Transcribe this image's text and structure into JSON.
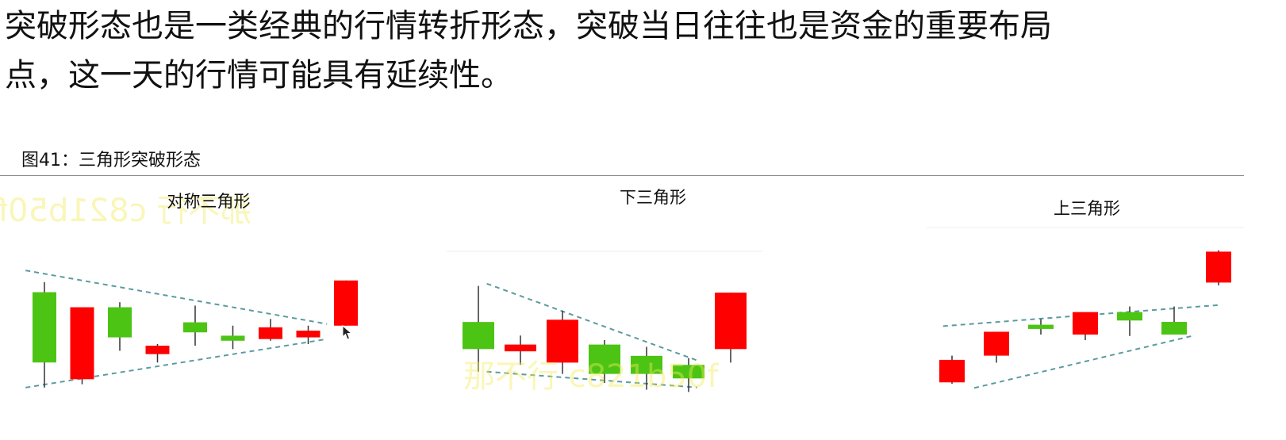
{
  "paragraph": {
    "line1": "突破形态也是一类经典的行情转折形态，突破当日往往也是资金的重要布局",
    "line2": "点，这一天的行情可能具有延续性。"
  },
  "figure": {
    "title": "图41：三角形突破形态"
  },
  "watermark": {
    "text": "那不行 c821b50f",
    "mirrored": true
  },
  "colors": {
    "up": "#ff0000",
    "down": "#4cc414",
    "trendline": "#5b9ba0",
    "text": "#111111"
  },
  "chart_data": [
    {
      "type": "candlestick",
      "title": "对称三角形",
      "candles": [
        {
          "open": 47,
          "close": 5,
          "high": 53,
          "low": -10,
          "color": "green"
        },
        {
          "open": -5,
          "close": 38,
          "high": 38,
          "low": -8,
          "color": "red"
        },
        {
          "open": 38,
          "close": 20,
          "high": 41,
          "low": 12,
          "color": "green"
        },
        {
          "open": 10,
          "close": 15,
          "high": 16,
          "low": 5,
          "color": "red"
        },
        {
          "open": 29,
          "close": 23,
          "high": 39,
          "low": 15,
          "color": "green"
        },
        {
          "open": 21,
          "close": 18,
          "high": 27,
          "low": 13,
          "color": "green"
        },
        {
          "open": 19,
          "close": 26,
          "high": 31,
          "low": 18,
          "color": "red"
        },
        {
          "open": 20,
          "close": 24,
          "high": 27,
          "low": 16,
          "color": "red"
        },
        {
          "open": 27,
          "close": 54,
          "high": 54,
          "low": 27,
          "color": "red"
        }
      ],
      "trendlines": [
        {
          "from": [
            -0.5,
            60
          ],
          "to": [
            7.5,
            28
          ]
        },
        {
          "from": [
            -0.5,
            -10
          ],
          "to": [
            7.5,
            19
          ]
        }
      ],
      "ylim": [
        -20,
        70
      ]
    },
    {
      "type": "candlestick",
      "title": "下三角形",
      "candles": [
        {
          "open": 50,
          "close": 38,
          "high": 66,
          "low": 28,
          "color": "green"
        },
        {
          "open": 37,
          "close": 40,
          "high": 44,
          "low": 31,
          "color": "red"
        },
        {
          "open": 32,
          "close": 51,
          "high": 55,
          "low": 27,
          "color": "red"
        },
        {
          "open": 40,
          "close": 27,
          "high": 42,
          "low": 23,
          "color": "green"
        },
        {
          "open": 35,
          "close": 27,
          "high": 39,
          "low": 20,
          "color": "green"
        },
        {
          "open": 31,
          "close": 25,
          "high": 34,
          "low": 19,
          "color": "green"
        },
        {
          "open": 38,
          "close": 63,
          "high": 63,
          "low": 32,
          "color": "red"
        }
      ],
      "trendlines": [
        {
          "from": [
            0.2,
            67
          ],
          "to": [
            5.2,
            33
          ]
        },
        {
          "from": [
            0.2,
            28
          ],
          "to": [
            5.2,
            21
          ]
        }
      ],
      "ylim": [
        10,
        75
      ]
    },
    {
      "type": "candlestick",
      "title": "上三角形",
      "candles": [
        {
          "open": 10,
          "close": 26,
          "high": 29,
          "low": 9,
          "color": "red"
        },
        {
          "open": 29,
          "close": 46,
          "high": 46,
          "low": 24,
          "color": "red"
        },
        {
          "open": 51,
          "close": 48,
          "high": 55,
          "low": 44,
          "color": "green"
        },
        {
          "open": 44,
          "close": 60,
          "high": 60,
          "low": 40,
          "color": "red"
        },
        {
          "open": 60,
          "close": 54,
          "high": 64,
          "low": 43,
          "color": "green"
        },
        {
          "open": 53,
          "close": 44,
          "high": 64,
          "low": 44,
          "color": "green"
        },
        {
          "open": 81,
          "close": 103,
          "high": 104,
          "low": 79,
          "color": "red"
        }
      ],
      "trendlines": [
        {
          "from": [
            -0.2,
            50
          ],
          "to": [
            6,
            65
          ]
        },
        {
          "from": [
            0.5,
            6
          ],
          "to": [
            5.4,
            43
          ]
        }
      ],
      "ylim": [
        0,
        110
      ]
    }
  ]
}
